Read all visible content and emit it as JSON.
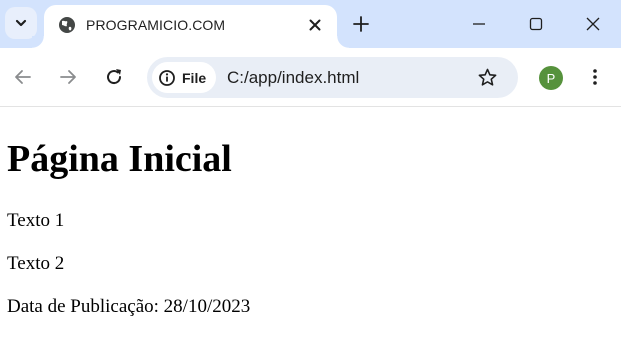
{
  "tab": {
    "title": "PROGRAMICIO.COM"
  },
  "address_bar": {
    "security_chip_label": "File",
    "url": "C:/app/index.html"
  },
  "profile": {
    "initial": "P",
    "color": "#56923c"
  },
  "icons": {
    "tab_menu": "chevron-down-icon",
    "favicon": "globe-icon",
    "tab_close": "close-icon",
    "new_tab": "plus-icon",
    "minimize": "minimize-icon",
    "maximize": "maximize-icon",
    "window_close": "close-icon",
    "back": "arrow-left-icon",
    "forward": "arrow-right-icon",
    "reload": "reload-icon",
    "site_info": "info-icon",
    "bookmark": "star-icon",
    "menu": "kebab-menu-icon"
  },
  "page": {
    "heading": "Página Inicial",
    "paragraphs": [
      "Texto 1",
      "Texto 2",
      "Data de Publicação: 28/10/2023"
    ]
  }
}
